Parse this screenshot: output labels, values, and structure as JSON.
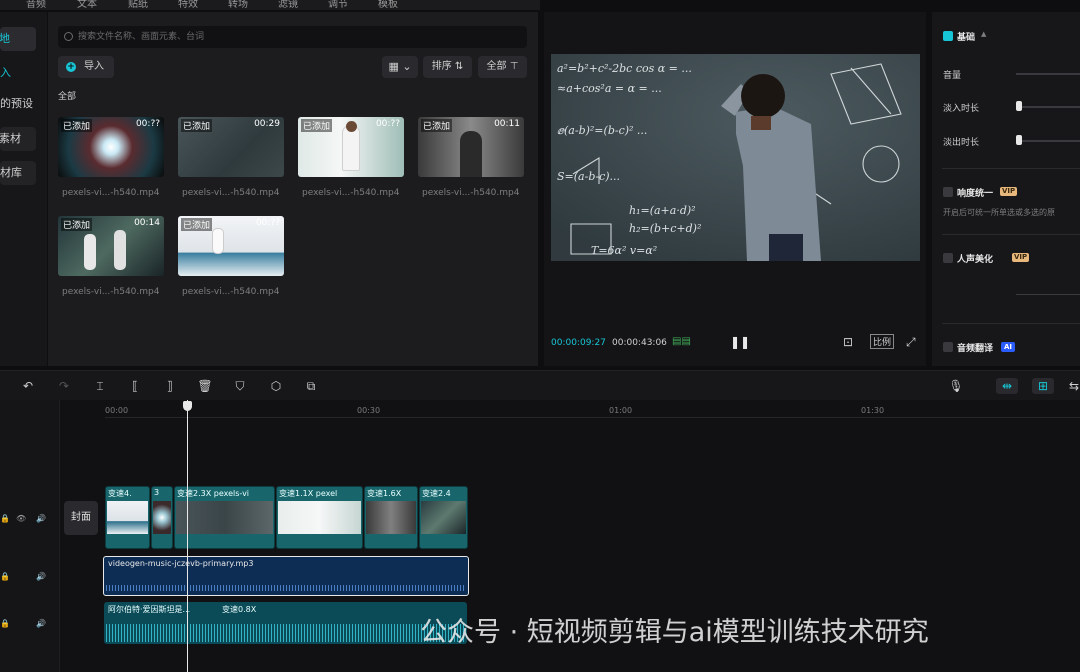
{
  "top_tabs": [
    "音频",
    "文本",
    "贴纸",
    "特效",
    "转场",
    "滤镜",
    "调节",
    "模板"
  ],
  "left_nav": [
    {
      "label": "本地",
      "active": true
    },
    {
      "label": "导入",
      "active": false
    },
    {
      "label": "我的预设",
      "active": false
    },
    {
      "label": "素材",
      "active": false
    },
    {
      "label": "素材库",
      "active": false
    }
  ],
  "media": {
    "search_placeholder": "搜索文件名称、画面元素、台词",
    "import_label": "导入",
    "sort_label": "排序",
    "filter_label": "全部",
    "all_label": "全部",
    "items": [
      {
        "badge": "已添加",
        "duration": "00:??",
        "name": "pexels-vi...-h540.mp4",
        "scene": "tunnel"
      },
      {
        "badge": "已添加",
        "duration": "00:29",
        "name": "pexels-vi...-h540.mp4",
        "scene": "chalk"
      },
      {
        "badge": "已添加",
        "duration": "00:??",
        "name": "pexels-vi...-h540.mp4",
        "scene": "lab"
      },
      {
        "badge": "已添加",
        "duration": "00:11",
        "name": "pexels-vi...-h540.mp4",
        "scene": "portrait"
      },
      {
        "badge": "已添加",
        "duration": "00:14",
        "name": "pexels-vi...-h540.mp4",
        "scene": "team"
      },
      {
        "badge": "已添加",
        "duration": "00:??",
        "name": "pexels-vi...-h540.mp4",
        "scene": "desk"
      }
    ]
  },
  "preview": {
    "current_time": "00:00:09:27",
    "total_time": "00:00:43:06",
    "ratio_label": "比例",
    "formula_lines": [
      "a²=b²+c²-2bc cos α = ...",
      "≈a+cos²a = α = ...",
      "ⅇ(a-b)²=(b-c)² ...",
      "S=(a-b-c)...",
      "h₁=(a+a·d)²",
      "h₂=(b+c+d)²",
      "T=6α² v=α²"
    ]
  },
  "props": {
    "basic_label": "基础",
    "volume_label": "音量",
    "fade_in_label": "淡入时长",
    "fade_out_label": "淡出时长",
    "loudness_label": "响度统一",
    "loudness_desc": "开启后可统一所单选或多选的原",
    "voice_beauty_label": "人声美化",
    "translate_label": "音频翻译",
    "vip_label": "VIP",
    "ai_label": "AI"
  },
  "timeline": {
    "ruler": [
      "00:00",
      "00:30",
      "01:00",
      "01:30"
    ],
    "cover_label": "封面",
    "clips": [
      {
        "label": "变速4.",
        "scene": "desk"
      },
      {
        "label": "3",
        "scene": "tunnel"
      },
      {
        "label": "变速2.3X  pexels-vi",
        "scene": "chalk"
      },
      {
        "label": "变速1.1X  pexel",
        "scene": "lab"
      },
      {
        "label": "变速1.6X",
        "scene": "portrait"
      },
      {
        "label": "变速2.4",
        "scene": "team"
      }
    ],
    "audio_label": "videogen-music-jczevb-primary.mp3",
    "music2_labels": [
      "阿尔伯特·爱因斯坦是...",
      "变速0.8X"
    ]
  },
  "watermark": "公众号 · 短视频剪辑与ai模型训练技术研究",
  "colors": {
    "accent": "#17c6d6",
    "audio_track": "#0e2d55",
    "video_clip": "#18666c",
    "vip": "#e7b77c"
  }
}
